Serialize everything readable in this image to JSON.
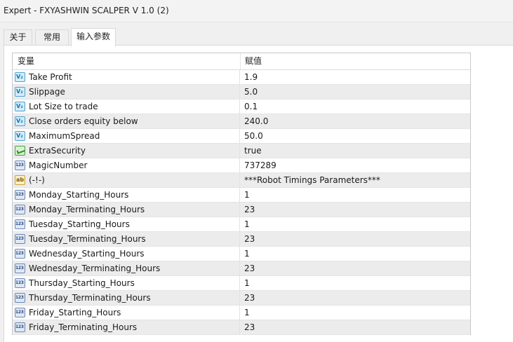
{
  "window": {
    "title": "Expert - FXYASHWIN SCALPER V 1.0 (2)"
  },
  "tabs": [
    {
      "label": "关于",
      "active": false
    },
    {
      "label": "常用",
      "active": false
    },
    {
      "label": "输入参数",
      "active": true
    }
  ],
  "grid": {
    "columns": [
      "变量",
      "赋值"
    ],
    "rows": [
      {
        "name": "Take Profit",
        "value": "1.9",
        "icon": "double-value-icon"
      },
      {
        "name": "Slippage",
        "value": "5.0",
        "icon": "double-value-icon"
      },
      {
        "name": "Lot Size to trade",
        "value": "0.1",
        "icon": "double-value-icon"
      },
      {
        "name": "Close orders equity below",
        "value": "240.0",
        "icon": "double-value-icon"
      },
      {
        "name": "MaximumSpread",
        "value": "50.0",
        "icon": "double-value-icon"
      },
      {
        "name": "ExtraSecurity",
        "value": "true",
        "icon": "bool-icon"
      },
      {
        "name": "MagicNumber",
        "value": "737289",
        "icon": "integer-icon"
      },
      {
        "name": "(-!-)",
        "value": "***Robot Timings Parameters***",
        "icon": "string-icon"
      },
      {
        "name": "Monday_Starting_Hours",
        "value": "1",
        "icon": "integer-icon"
      },
      {
        "name": "Monday_Terminating_Hours",
        "value": "23",
        "icon": "integer-icon"
      },
      {
        "name": "Tuesday_Starting_Hours",
        "value": "1",
        "icon": "integer-icon"
      },
      {
        "name": "Tuesday_Terminating_Hours",
        "value": "23",
        "icon": "integer-icon"
      },
      {
        "name": "Wednesday_Starting_Hours",
        "value": "1",
        "icon": "integer-icon"
      },
      {
        "name": "Wednesday_Terminating_Hours",
        "value": "23",
        "icon": "integer-icon"
      },
      {
        "name": "Thursday_Starting_Hours",
        "value": "1",
        "icon": "integer-icon"
      },
      {
        "name": "Thursday_Terminating_Hours",
        "value": "23",
        "icon": "integer-icon"
      },
      {
        "name": "Friday_Starting_Hours",
        "value": "1",
        "icon": "integer-icon"
      },
      {
        "name": "Friday_Terminating_Hours",
        "value": "23",
        "icon": "integer-icon"
      }
    ]
  }
}
